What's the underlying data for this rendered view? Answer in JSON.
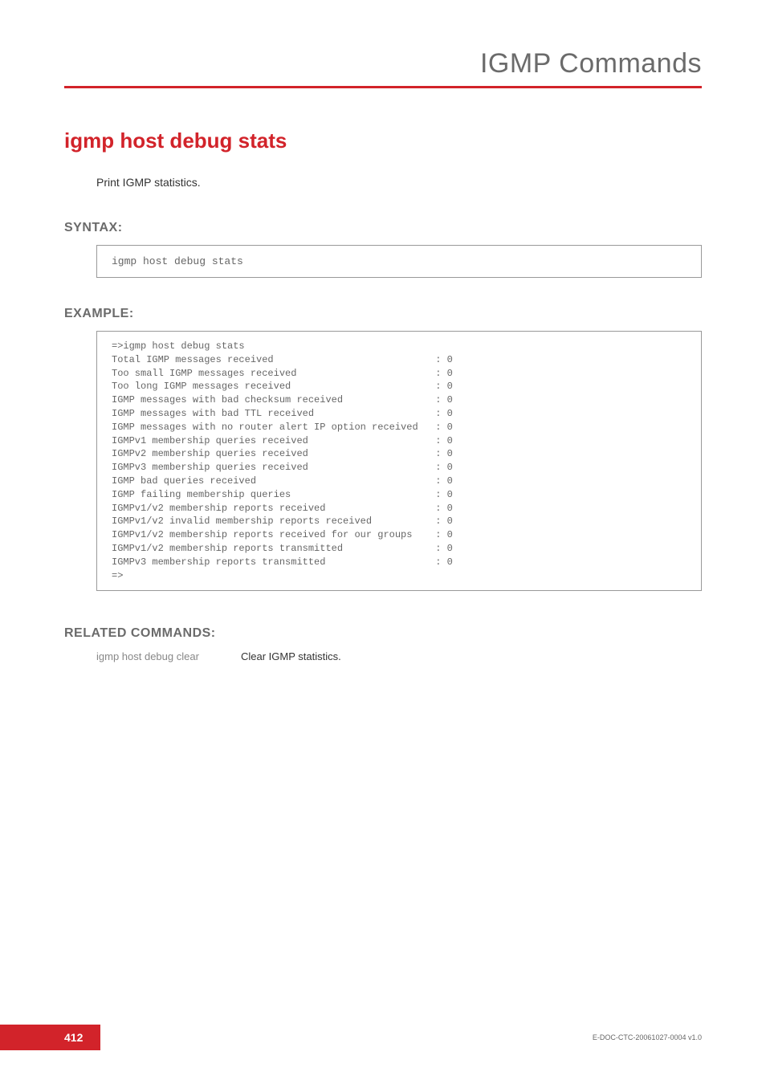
{
  "header": {
    "title": "IGMP Commands"
  },
  "main_heading": "igmp host debug stats",
  "description": "Print IGMP statistics.",
  "syntax": {
    "label": "SYNTAX:",
    "code": "igmp host debug stats"
  },
  "example": {
    "label": "EXAMPLE:",
    "text": "=>igmp host debug stats\nTotal IGMP messages received                            : 0\nToo small IGMP messages received                        : 0\nToo long IGMP messages received                         : 0\nIGMP messages with bad checksum received                : 0\nIGMP messages with bad TTL received                     : 0\nIGMP messages with no router alert IP option received   : 0\nIGMPv1 membership queries received                      : 0\nIGMPv2 membership queries received                      : 0\nIGMPv3 membership queries received                      : 0\nIGMP bad queries received                               : 0\nIGMP failing membership queries                         : 0\nIGMPv1/v2 membership reports received                   : 0\nIGMPv1/v2 invalid membership reports received           : 0\nIGMPv1/v2 membership reports received for our groups    : 0\nIGMPv1/v2 membership reports transmitted                : 0\nIGMPv3 membership reports transmitted                   : 0\n=>"
  },
  "related": {
    "label": "RELATED COMMANDS:",
    "rows": [
      {
        "cmd": "igmp host debug clear",
        "desc": "Clear IGMP statistics."
      }
    ]
  },
  "footer": {
    "page": "412",
    "docid": "E-DOC-CTC-20061027-0004 v1.0"
  }
}
